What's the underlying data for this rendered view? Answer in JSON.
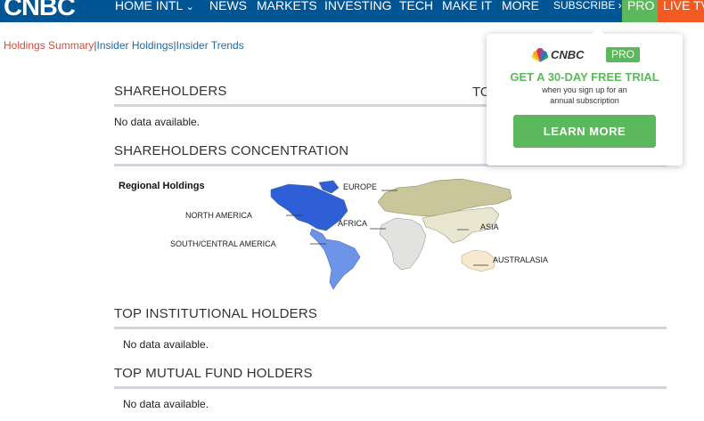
{
  "nav": {
    "logo": "CNBC",
    "items": [
      "HOME INTL",
      "NEWS",
      "MARKETS",
      "INVESTING",
      "TECH",
      "MAKE IT",
      "MORE"
    ],
    "subscribe": "SUBSCRIBE ›",
    "pro": "PRO",
    "live": "LIVE TV"
  },
  "subnav": {
    "active": "Holdings Summary",
    "link1": "Insider Holdings",
    "link2": "Insider Trends"
  },
  "sections": {
    "shareholders": {
      "title": "SHAREHOLDERS",
      "nodata": "No data available.",
      "right_head": "TO"
    },
    "concentration": {
      "title": "SHAREHOLDERS CONCENTRATION"
    },
    "institutional": {
      "title": "TOP INSTITUTIONAL HOLDERS",
      "nodata": "No data available."
    },
    "mutual": {
      "title": "TOP MUTUAL FUND HOLDERS",
      "nodata": "No data available."
    }
  },
  "map": {
    "title": "Regional Holdings",
    "regions": {
      "north_america": "NORTH AMERICA",
      "south_america": "SOUTH/CENTRAL AMERICA",
      "europe": "EUROPE",
      "africa": "AFRICA",
      "asia": "ASIA",
      "australasia": "AUSTRALASIA"
    },
    "colors": {
      "north_america": "#2f5fd6",
      "south_america": "#6c95ea",
      "europe": "#c8c69a",
      "africa": "#e2e2e0",
      "asia": "#e8e6cf",
      "australasia": "#f6e9cf"
    }
  },
  "promo": {
    "brand": "CNBC",
    "badge": "PRO",
    "headline": "GET A 30-DAY FREE TRIAL",
    "sub1": "when you sign up for an",
    "sub2": "annual subscription",
    "button": "LEARN MORE"
  }
}
